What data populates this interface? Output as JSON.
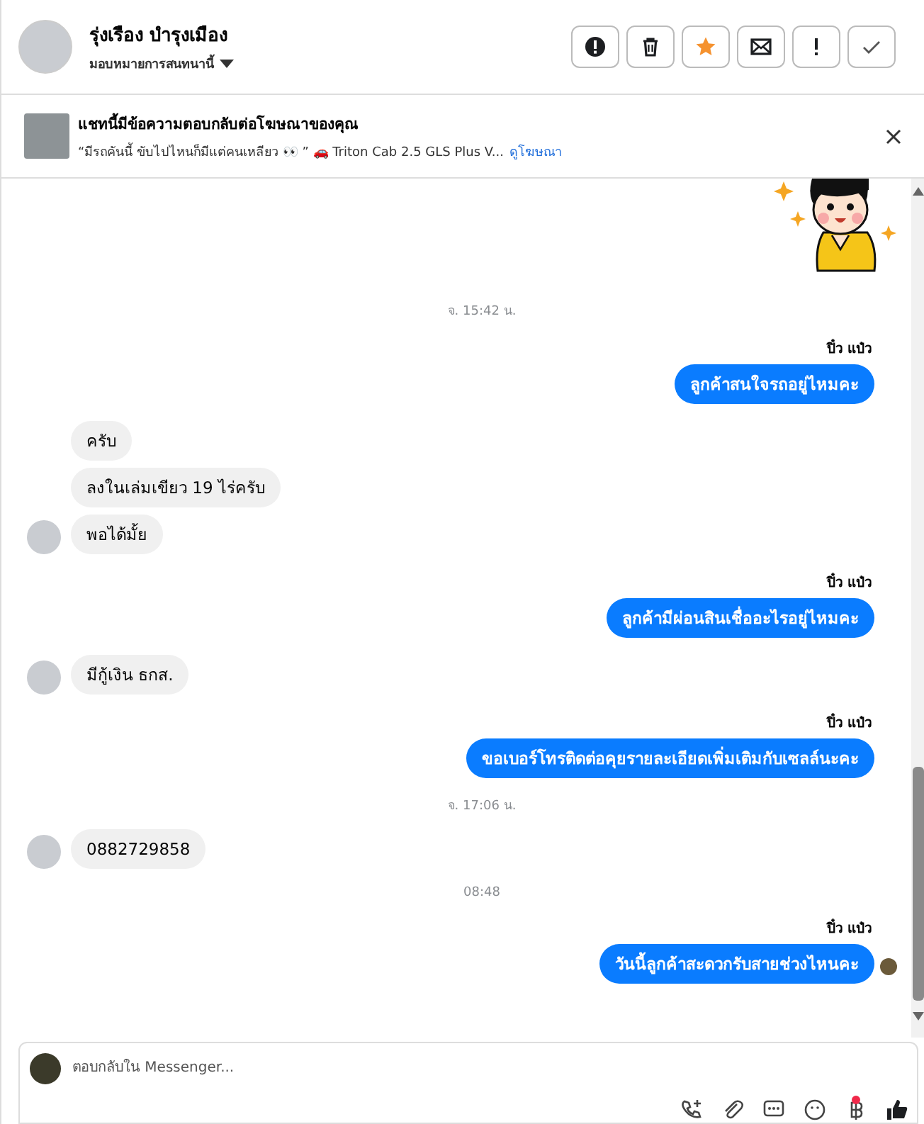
{
  "conversation": {
    "name": "รุ่งเรือง บำรุงเมือง",
    "assign_label": "มอบหมายการสนทนานี้"
  },
  "actions": [
    {
      "kind": "spam",
      "on": false
    },
    {
      "kind": "delete",
      "on": false
    },
    {
      "kind": "star",
      "on": true
    },
    {
      "kind": "unread",
      "on": false
    },
    {
      "kind": "important",
      "on": false
    },
    {
      "kind": "done",
      "on": false
    }
  ],
  "ad_notice": {
    "title": "แชทนี้มีข้อความตอบกลับต่อโฆษณาของคุณ",
    "snippet": "“มีรถคันนี้ ขับไปไหนก็มีแต่คนเหลียว 👀 ” 🚗 Triton Cab 2.5 GLS Plus V...",
    "link": "ดูโฆษณา"
  },
  "messages": [
    {
      "kind": "sticker"
    },
    {
      "kind": "time",
      "text": "จ. 15:42 น."
    },
    {
      "kind": "sender",
      "text": "ปิ๋ว แป๋ว"
    },
    {
      "kind": "out",
      "text": "ลูกค้าสนใจรถอยู่ไหมคะ",
      "seen": false
    },
    {
      "kind": "in",
      "text": "ครับ",
      "avatar": false
    },
    {
      "kind": "in",
      "text": "ลงในเล่มเขียว 19 ไร่ครับ",
      "avatar": false
    },
    {
      "kind": "in",
      "text": "พอได้มั้ย",
      "avatar": true
    },
    {
      "kind": "sender",
      "text": "ปิ๋ว แป๋ว"
    },
    {
      "kind": "out",
      "text": "ลูกค้ามีผ่อนสินเชื่ออะไรอยู่ไหมคะ",
      "seen": false
    },
    {
      "kind": "in",
      "text": "มีกู้เงิน ธกส.",
      "avatar": true
    },
    {
      "kind": "sender",
      "text": "ปิ๋ว แป๋ว"
    },
    {
      "kind": "out",
      "text": "ขอเบอร์โทรติดต่อคุยรายละเอียดเพิ่มเติมกับเซลล์นะคะ",
      "seen": false
    },
    {
      "kind": "time",
      "text": "จ. 17:06 น."
    },
    {
      "kind": "in",
      "text": "0882729858",
      "avatar": true
    },
    {
      "kind": "time",
      "text": "08:48"
    },
    {
      "kind": "sender",
      "text": "ปิ๋ว แป๋ว"
    },
    {
      "kind": "out",
      "text": "วันนี้ลูกค้าสะดวกรับสายช่วงไหนคะ",
      "seen": true
    }
  ],
  "composer": {
    "placeholder": "ตอบกลับใน Messenger..."
  }
}
